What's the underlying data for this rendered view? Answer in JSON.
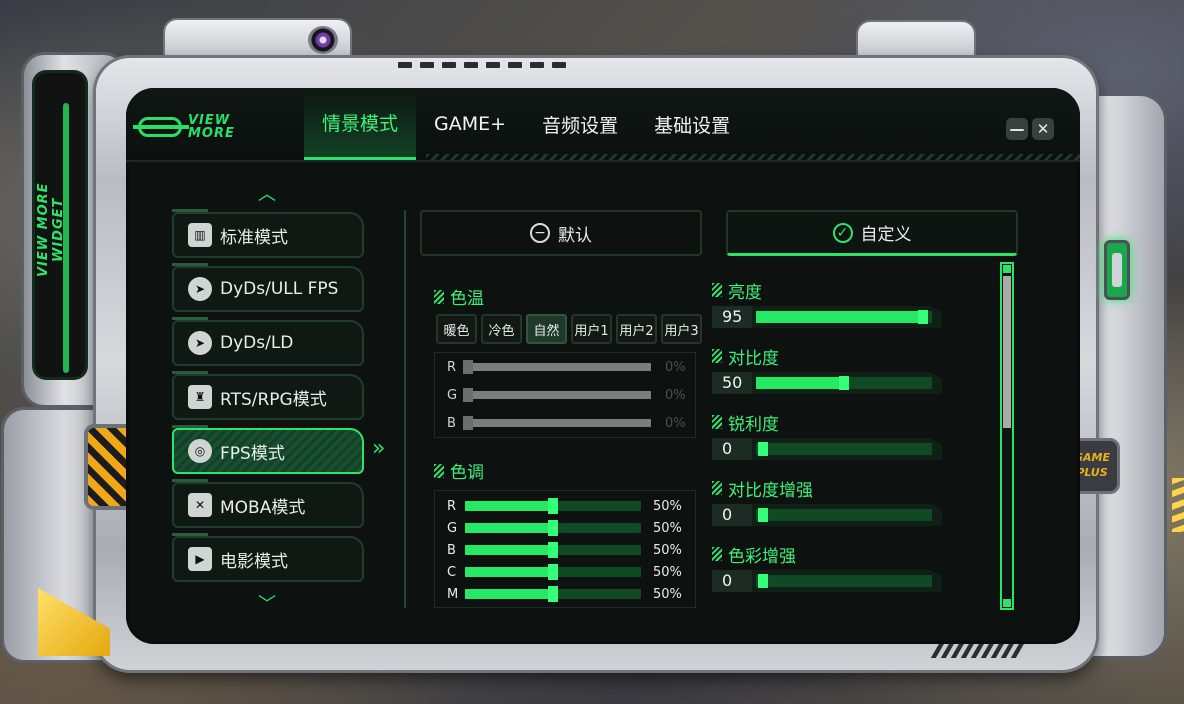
{
  "side_label": "VIEW MORE WIDGET",
  "logo": {
    "line1": "VIEW",
    "line2": "MORE"
  },
  "nav": [
    {
      "label": "情景模式",
      "active": true
    },
    {
      "label": "GAME+",
      "active": false
    },
    {
      "label": "音频设置",
      "active": false
    },
    {
      "label": "基础设置",
      "active": false
    }
  ],
  "window_buttons": {
    "minimize": "—",
    "close": "✕"
  },
  "menu": {
    "scroll_up_icon": "chevron-up-icon",
    "scroll_down_icon": "chevron-down-icon",
    "items": [
      {
        "label": "标准模式",
        "icon": "chart-icon",
        "active": false
      },
      {
        "label": "DyDs/ULL FPS",
        "icon": "speed-icon",
        "active": false
      },
      {
        "label": "DyDs/LD",
        "icon": "speed-icon",
        "active": false
      },
      {
        "label": "RTS/RPG模式",
        "icon": "chess-icon",
        "active": false
      },
      {
        "label": "FPS模式",
        "icon": "target-icon",
        "active": true
      },
      {
        "label": "MOBA模式",
        "icon": "swords-icon",
        "active": false
      },
      {
        "label": "电影模式",
        "icon": "film-icon",
        "active": false
      }
    ]
  },
  "segments": {
    "default_label": "默认",
    "custom_label": "自定义",
    "selected": "自定义"
  },
  "color_temp": {
    "title": "色温",
    "presets": [
      {
        "label": "暖色",
        "active": false
      },
      {
        "label": "冷色",
        "active": false
      },
      {
        "label": "自然",
        "active": true
      },
      {
        "label": "用户1",
        "active": false
      },
      {
        "label": "用户2",
        "active": false
      },
      {
        "label": "用户3",
        "active": false
      }
    ],
    "rows": [
      {
        "label": "R",
        "value": "0%"
      },
      {
        "label": "G",
        "value": "0%"
      },
      {
        "label": "B",
        "value": "0%"
      }
    ]
  },
  "hue": {
    "title": "色调",
    "rows": [
      {
        "label": "R",
        "value": "50%",
        "level": 50
      },
      {
        "label": "G",
        "value": "50%",
        "level": 50
      },
      {
        "label": "B",
        "value": "50%",
        "level": 50
      },
      {
        "label": "C",
        "value": "50%",
        "level": 50
      },
      {
        "label": "M",
        "value": "50%",
        "level": 50
      }
    ]
  },
  "adjustments": [
    {
      "label": "亮度",
      "value": "95",
      "level": 95
    },
    {
      "label": "对比度",
      "value": "50",
      "level": 50
    },
    {
      "label": "锐利度",
      "value": "0",
      "level": 0
    },
    {
      "label": "对比度增强",
      "value": "0",
      "level": 0
    },
    {
      "label": "色彩增强",
      "value": "0",
      "level": 0
    }
  ],
  "badge": {
    "line1": "GAME",
    "line2": "PLUS"
  },
  "colors": {
    "accent": "#2ee36a",
    "screen_bg": "#0d1210",
    "frame": "#c6c9ce",
    "hazard": "#f0a817"
  }
}
